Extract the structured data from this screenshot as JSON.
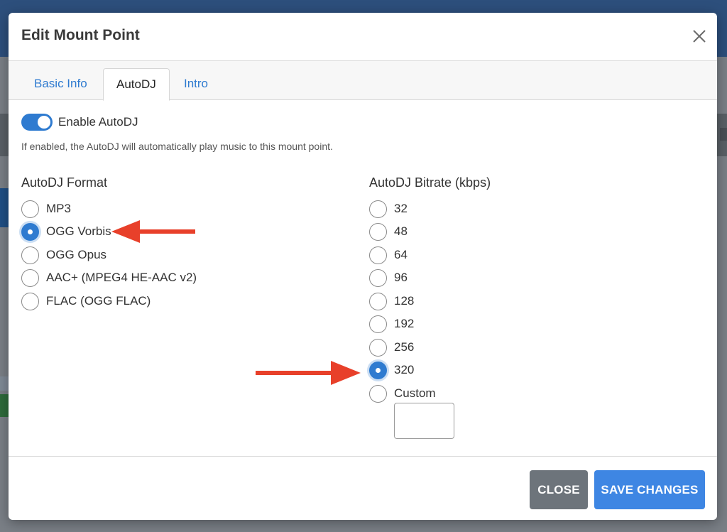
{
  "modal": {
    "title": "Edit Mount Point"
  },
  "tabs": [
    {
      "label": "Basic Info",
      "active": false
    },
    {
      "label": "AutoDJ",
      "active": true
    },
    {
      "label": "Intro",
      "active": false
    }
  ],
  "autodj_toggle": {
    "label": "Enable AutoDJ",
    "enabled": true,
    "help_text": "If enabled, the AutoDJ will automatically play music to this mount point."
  },
  "format": {
    "label": "AutoDJ Format",
    "selected": "OGG Vorbis",
    "options": [
      "MP3",
      "OGG Vorbis",
      "OGG Opus",
      "AAC+ (MPEG4 HE-AAC v2)",
      "FLAC (OGG FLAC)"
    ]
  },
  "bitrate": {
    "label": "AutoDJ Bitrate (kbps)",
    "selected": "320",
    "options": [
      "32",
      "48",
      "64",
      "96",
      "128",
      "192",
      "256",
      "320",
      "Custom"
    ],
    "custom_value": ""
  },
  "footer": {
    "close_label": "CLOSE",
    "save_label": "SAVE CHANGES"
  },
  "colors": {
    "accent": "#2f7bd0",
    "annotation_arrow": "#e8402a",
    "close_button": "#6d747b",
    "save_button": "#3e86e3"
  },
  "icons": {
    "close": "close-icon",
    "annotation": "arrow-icon"
  }
}
